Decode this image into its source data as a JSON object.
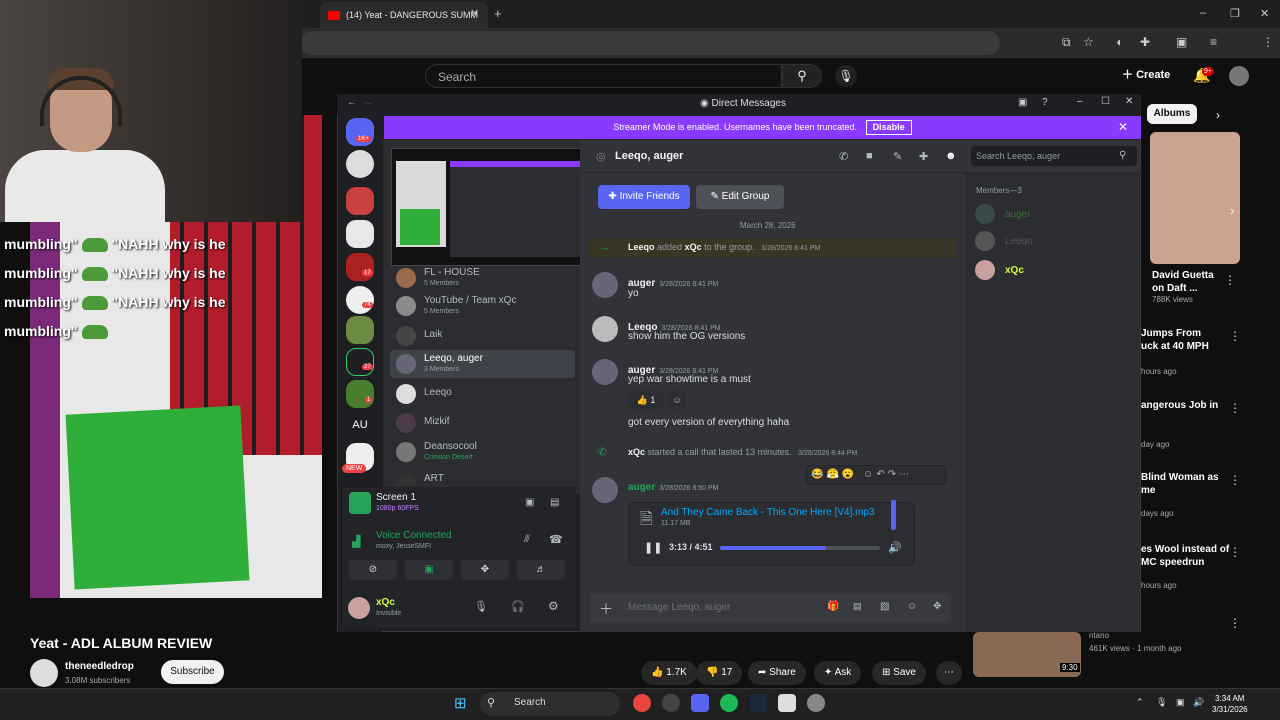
{
  "browser": {
    "tab_title": "(14) Yeat - DANGEROUS SUMM",
    "new_tab": "+",
    "tab_close": "✕"
  },
  "youtube": {
    "search_placeholder": "Search",
    "create_label": "Create",
    "notif_badge": "9+",
    "video_title": "Yeat - ADL ALBUM REVIEW",
    "channel_name": "theneedledrop",
    "subscribers": "3.08M subscribers",
    "subscribe_label": "Subscribe",
    "likes": "1.7K",
    "dislikes": "17",
    "share_label": "Share",
    "ask_label": "Ask",
    "save_label": "Save",
    "albums_chip": "Albums",
    "recommendations": [
      {
        "title1": "David Guetta",
        "title2": "on Daft ...",
        "meta": "788K views"
      },
      {
        "title1": "Jumps From",
        "title2": "uck at 40 MPH",
        "meta": "hours ago"
      },
      {
        "title1": "angerous Job in",
        "title2": "",
        "meta": "day ago"
      },
      {
        "title1": "Blind Woman as",
        "title2": "me",
        "meta": "days ago"
      },
      {
        "title1": "es Wool instead of",
        "title2": "MC speedrun",
        "meta": "hours ago"
      },
      {
        "title1": "ntano",
        "title2": "461K views · 1 month ago",
        "meta": "9:30"
      }
    ]
  },
  "stream_chat": {
    "lines": [
      "mumbling\"",
      "mumbling\"",
      "mumbling\"",
      "mumbling\""
    ],
    "quote": "\"NAHH why is he",
    "header": "why is he"
  },
  "discord": {
    "window_title": "Direct Messages",
    "banner_text": "Streamer Mode is enabled. Usernames have been truncated.",
    "banner_button": "Disable",
    "guild_badges": {
      "top": "1K+",
      "g5": "17",
      "g6": "74",
      "g8": "27",
      "g9": "1"
    },
    "guild_au": "AU",
    "guild_new": "NEW",
    "dms": [
      {
        "name": "FL - HOUSE",
        "sub": "5 Members"
      },
      {
        "name": "YouTube / Team xQc",
        "sub": "5 Members"
      },
      {
        "name": "Laik",
        "sub": ""
      },
      {
        "name": "Leeqo, auger",
        "sub": "3 Members"
      },
      {
        "name": "Leeqo",
        "sub": ""
      },
      {
        "name": "Mizkif",
        "sub": ""
      },
      {
        "name": "Deansocool",
        "sub": "Crimson Desert"
      },
      {
        "name": "ART",
        "sub": ""
      }
    ],
    "screen_share": {
      "title": "Screen 1",
      "sub": "1080p 60FPS"
    },
    "voice": {
      "status": "Voice Connected",
      "sub": "moxy, JesseSMFI"
    },
    "user": {
      "name": "xQc",
      "status": "Invisible"
    },
    "channel_name": "Leeqo, auger",
    "search_placeholder": "Search Leeqo, auger",
    "invite_label": "Invite Friends",
    "edit_group_label": "Edit Group",
    "date_divider": "March 28, 2026",
    "system_add": {
      "actor": "Leeqo",
      "verb": "added",
      "target": "xQc",
      "rest": "to the group.",
      "ts": "3/28/2026 8:41 PM"
    },
    "messages": [
      {
        "author": "auger",
        "ts": "3/28/2026 8:41 PM",
        "text": "yo"
      },
      {
        "author": "Leeqo",
        "ts": "3/28/2026 8:41 PM",
        "text": "show him the OG versions"
      },
      {
        "author": "auger",
        "ts": "3/28/2026 8:41 PM",
        "text": "yep war showtime is a must",
        "reaction": "1",
        "text2": "got every version of everything haha"
      }
    ],
    "call_line": {
      "actor": "xQc",
      "text": "started a call that lasted 13 minutes.",
      "ts": "3/28/2026 8:44 PM"
    },
    "last_msg": {
      "author": "auger",
      "ts": "3/28/2026 8:50 PM"
    },
    "audio": {
      "file": "And They Came Back - This One Here [V4].mp3",
      "size": "11.17 MB",
      "time": "3:13 / 4:51",
      "progress": 0.663
    },
    "input_placeholder": "Message Leeqo, auger",
    "members_header": "Members—3",
    "members": [
      "auger",
      "Leeqo",
      "xQc"
    ]
  },
  "taskbar": {
    "search": "Search",
    "time": "3:34 AM",
    "date": "3/31/2026"
  },
  "colors": {
    "accent": "#5865f2",
    "banner": "#8a39ff",
    "yt_red": "#ff0000",
    "online": "#23a55a"
  }
}
